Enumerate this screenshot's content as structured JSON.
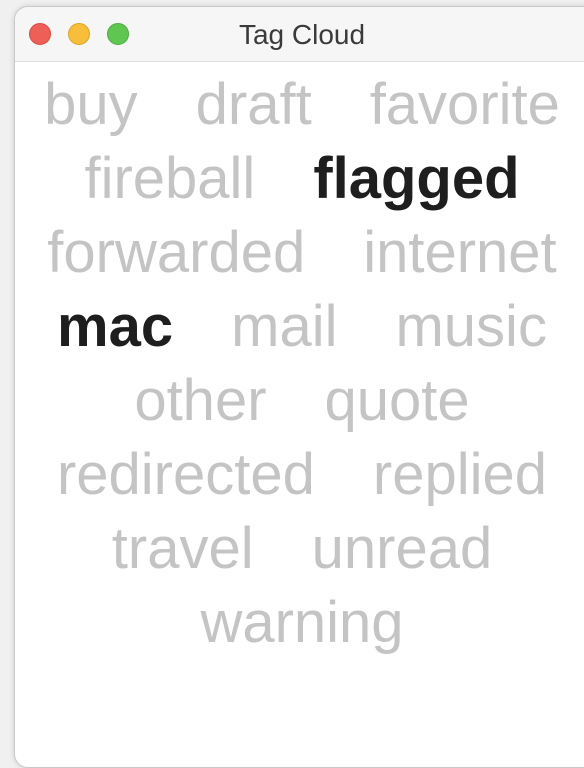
{
  "window": {
    "title": "Tag Cloud"
  },
  "tags": {
    "buy": "buy",
    "draft": "draft",
    "favorite": "favorite",
    "fireball": "fireball",
    "flagged": "flagged",
    "forwarded": "forwarded",
    "internet": "internet",
    "mac": "mac",
    "mail": "mail",
    "music": "music",
    "other": "other",
    "quote": "quote",
    "redirected": "redirected",
    "replied": "replied",
    "travel": "travel",
    "unread": "unread",
    "warning": "warning"
  },
  "selected_tags": [
    "flagged",
    "mac"
  ],
  "colors": {
    "tag_default": "#c4c4c4",
    "tag_selected": "#1e1e1e",
    "close": "#ee5f58",
    "minimize": "#f6be3b",
    "maximize": "#5fc751"
  }
}
